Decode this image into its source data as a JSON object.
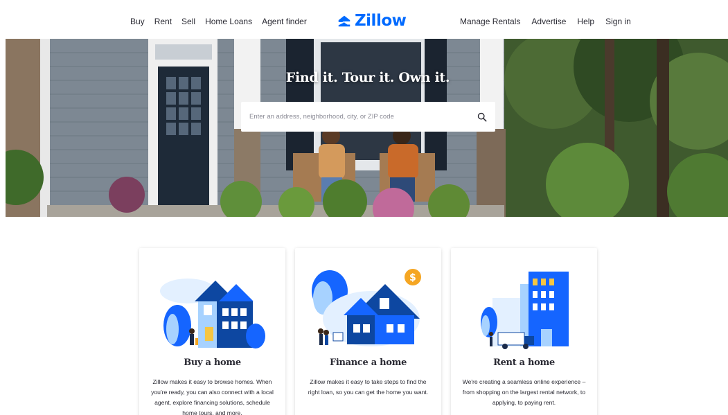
{
  "header": {
    "nav_left": [
      "Buy",
      "Rent",
      "Sell",
      "Home Loans",
      "Agent finder"
    ],
    "logo_text": "Zillow",
    "nav_right": [
      "Manage Rentals",
      "Advertise",
      "Help",
      "Sign in"
    ]
  },
  "hero": {
    "title": "Find it. Tour it. Own it.",
    "search_placeholder": "Enter an address, neighborhood, city, or ZIP code",
    "search_icon": "search-icon"
  },
  "cards": [
    {
      "title": "Buy a home",
      "desc": "Zillow makes it easy to browse homes. When you're ready, you can also connect with a local agent, explore financing solutions, schedule home tours, and more.",
      "icon": "house-illustration"
    },
    {
      "title": "Finance a home",
      "desc": "Zillow makes it easy to take steps to find the right loan, so you can get the home you want.",
      "icon": "finance-house-illustration"
    },
    {
      "title": "Rent a home",
      "desc": "We're creating a seamless online experience – from shopping on the largest rental network, to applying, to paying rent.",
      "icon": "rental-building-illustration"
    }
  ],
  "colors": {
    "brand_blue": "#006aff",
    "text": "#2a2a33",
    "illus_navy": "#0d47a1",
    "illus_light": "#a7d2ff",
    "accent_gold": "#f5a623"
  }
}
